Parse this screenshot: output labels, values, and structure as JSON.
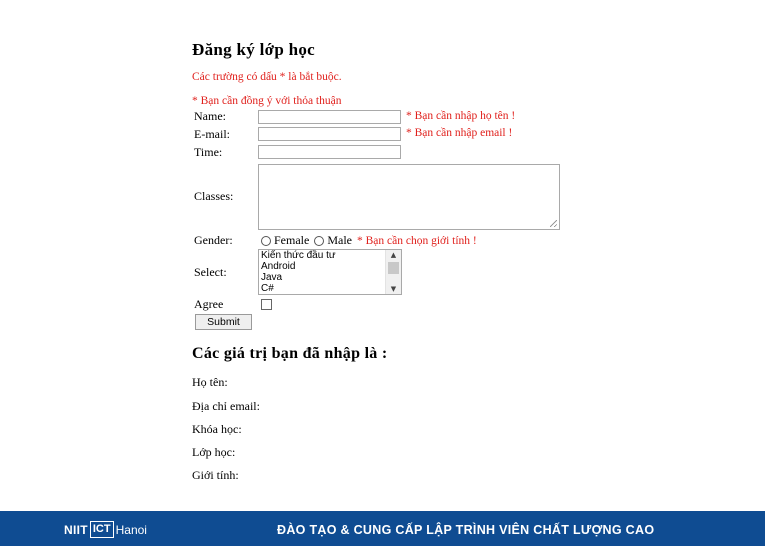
{
  "form": {
    "title": "Đăng ký lớp học",
    "required_note": "Các trường có dấu * là bắt buộc.",
    "agree_error": "* Bạn cần đồng ý với thỏa thuận",
    "fields": {
      "name": {
        "label": "Name:",
        "value": "",
        "error": "* Bạn cần nhập họ tên !"
      },
      "email": {
        "label": "E-mail:",
        "value": "",
        "error": "* Bạn cần nhập email !"
      },
      "time": {
        "label": "Time:",
        "value": ""
      },
      "classes": {
        "label": "Classes:",
        "value": ""
      },
      "gender": {
        "label": "Gender:",
        "options": [
          "Female",
          "Male"
        ],
        "error": "* Bạn cần chọn giới tính !"
      },
      "select": {
        "label": "Select:",
        "options": [
          "Kiến thức đầu tư",
          "Android",
          "Java",
          "C#"
        ]
      },
      "agree": {
        "label": "Agree",
        "checked": false
      }
    },
    "submit_label": "Submit"
  },
  "results": {
    "title": "Các giá trị bạn đã nhập là :",
    "labels": {
      "name": "Họ tên:",
      "email": "Địa chỉ email:",
      "course": "Khóa học:",
      "class": "Lớp học:",
      "gender": "Giới tính:"
    }
  },
  "footer": {
    "logo_niit": "NIIT",
    "logo_box": "ICT",
    "logo_city": "Hanoi",
    "tagline": "ĐÀO TẠO & CUNG CẤP LẬP TRÌNH VIÊN CHẤT LƯỢNG CAO"
  },
  "colors": {
    "error": "#e0201c",
    "footer_bg": "#0f4c92"
  }
}
